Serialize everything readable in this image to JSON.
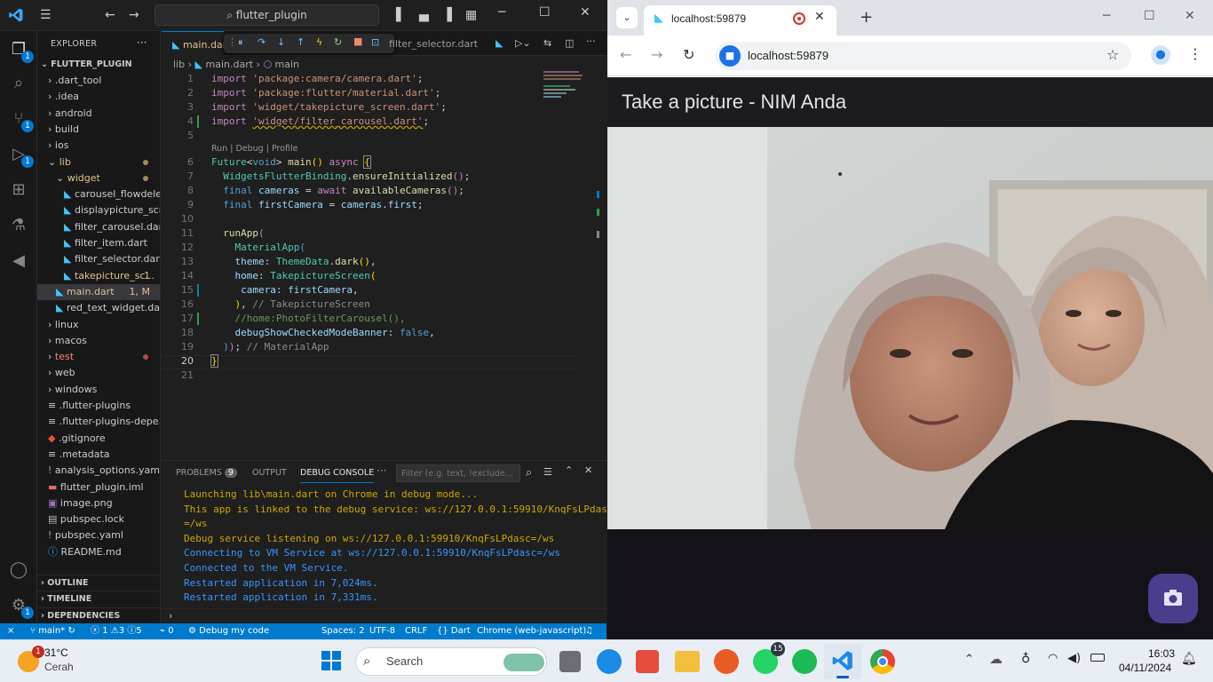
{
  "vscode": {
    "search_text": "flutter_plugin",
    "explorer_title": "EXPLORER",
    "project": "FLUTTER_PLUGIN",
    "tree": [
      {
        "label": ".dart_tool",
        "indent": 1,
        "type": "folder"
      },
      {
        "label": ".idea",
        "indent": 1,
        "type": "folder"
      },
      {
        "label": "android",
        "indent": 1,
        "type": "folder"
      },
      {
        "label": "build",
        "indent": 1,
        "type": "folder"
      },
      {
        "label": "ios",
        "indent": 1,
        "type": "folder"
      },
      {
        "label": "lib",
        "indent": 1,
        "type": "folder-open",
        "color": "#e2c08d"
      },
      {
        "label": "widget",
        "indent": 2,
        "type": "folder-open",
        "color": "#e2c08d"
      },
      {
        "label": "carousel_flowdeleg...",
        "indent": 3,
        "type": "dart"
      },
      {
        "label": "displaypicture_scre...",
        "indent": 3,
        "type": "dart"
      },
      {
        "label": "filter_carousel.dart",
        "indent": 3,
        "type": "dart"
      },
      {
        "label": "filter_item.dart",
        "indent": 3,
        "type": "dart"
      },
      {
        "label": "filter_selector.dart",
        "indent": 3,
        "type": "dart"
      },
      {
        "label": "takepicture_sc...",
        "indent": 3,
        "type": "dart",
        "color": "#e2c08d",
        "badge": "1"
      },
      {
        "label": "main.dart",
        "indent": 2,
        "type": "dart",
        "color": "#e2c08d",
        "badge": "1, M",
        "selected": true
      },
      {
        "label": "red_text_widget.dart",
        "indent": 2,
        "type": "dart"
      },
      {
        "label": "linux",
        "indent": 1,
        "type": "folder"
      },
      {
        "label": "macos",
        "indent": 1,
        "type": "folder"
      },
      {
        "label": "test",
        "indent": 1,
        "type": "folder",
        "color": "#f48771"
      },
      {
        "label": "web",
        "indent": 1,
        "type": "folder"
      },
      {
        "label": "windows",
        "indent": 1,
        "type": "folder"
      },
      {
        "label": ".flutter-plugins",
        "indent": 1,
        "type": "file"
      },
      {
        "label": ".flutter-plugins-depe...",
        "indent": 1,
        "type": "file"
      },
      {
        "label": ".gitignore",
        "indent": 1,
        "type": "git"
      },
      {
        "label": ".metadata",
        "indent": 1,
        "type": "file"
      },
      {
        "label": "analysis_options.yaml",
        "indent": 1,
        "type": "yaml"
      },
      {
        "label": "flutter_plugin.iml",
        "indent": 1,
        "type": "iml"
      },
      {
        "label": "image.png",
        "indent": 1,
        "type": "image"
      },
      {
        "label": "pubspec.lock",
        "indent": 1,
        "type": "lock"
      },
      {
        "label": "pubspec.yaml",
        "indent": 1,
        "type": "yaml"
      },
      {
        "label": "README.md",
        "indent": 1,
        "type": "info"
      }
    ],
    "sections": {
      "outline": "OUTLINE",
      "timeline": "TIMELINE",
      "dependencies": "DEPENDENCIES"
    },
    "tabs": {
      "main": "main.dart",
      "second": "filter_selector.dart"
    },
    "breadcrumb": {
      "lib": "lib",
      "file": "main.dart",
      "symbol": "main"
    },
    "codelens": "Run | Debug | Profile",
    "code_comments": {
      "l16": "// TakepictureScreen",
      "l17": "//home:PhotoFilterCarousel(),",
      "l19": "// MaterialApp"
    },
    "panel_tabs": {
      "problems": "PROBLEMS",
      "problems_count": "9",
      "output": "OUTPUT",
      "debug": "DEBUG CONSOLE"
    },
    "filter_placeholder": "Filter (e.g. text, !exclude...",
    "console": [
      {
        "text": "Launching lib\\main.dart on Chrome in debug mode...",
        "color": "#cca700"
      },
      {
        "text": "This app is linked to the debug service: ws://127.0.0.1:59910/KnqFsLPdasc",
        "color": "#cca700"
      },
      {
        "text": "=/ws",
        "color": "#cca700"
      },
      {
        "text": "Debug service listening on ws://127.0.0.1:59910/KnqFsLPdasc=/ws",
        "color": "#cca700"
      },
      {
        "text": "Connecting to VM Service at ws://127.0.0.1:59910/KnqFsLPdasc=/ws",
        "color": "#3794ff"
      },
      {
        "text": "Connected to the VM Service.",
        "color": "#3794ff"
      },
      {
        "text": "Restarted application in 7,024ms.",
        "color": "#3794ff"
      },
      {
        "text": "Restarted application in 7,331ms.",
        "color": "#3794ff"
      }
    ],
    "status": {
      "branch": "main*",
      "errors": "1",
      "warnings": "3",
      "info": "5",
      "ports": "0",
      "debug": "Debug my code",
      "spaces": "Spaces: 2",
      "encoding": "UTF-8",
      "eol": "CRLF",
      "lang": "Dart",
      "device": "Chrome (web-javascript)"
    }
  },
  "chrome": {
    "tab_title": "localhost:59879",
    "url": "localhost:59879"
  },
  "app": {
    "title": "Take a picture - NIM Anda"
  },
  "taskbar": {
    "temp": "31°C",
    "weather": "Cerah",
    "weather_badge": "1",
    "search": "Search",
    "whatsapp_badge": "15",
    "time": "16:03",
    "date": "04/11/2024"
  }
}
